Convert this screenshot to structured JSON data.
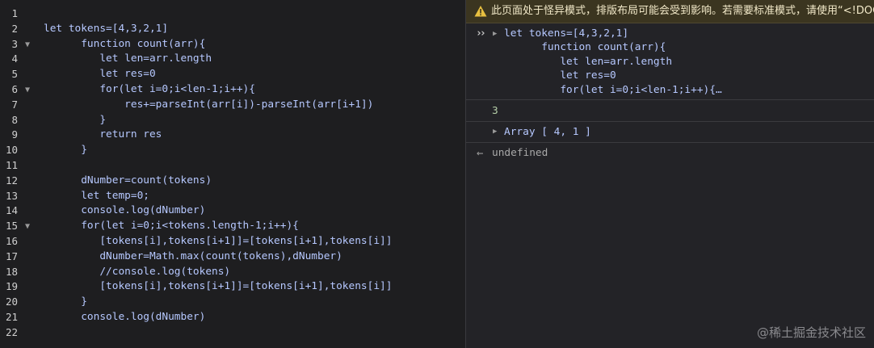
{
  "editor": {
    "lines": [
      {
        "n": "1",
        "fold": false,
        "text": ""
      },
      {
        "n": "2",
        "fold": false,
        "text": "let tokens=[4,3,2,1]"
      },
      {
        "n": "3",
        "fold": true,
        "text": "      function count(arr){"
      },
      {
        "n": "4",
        "fold": false,
        "text": "         let len=arr.length"
      },
      {
        "n": "5",
        "fold": false,
        "text": "         let res=0"
      },
      {
        "n": "6",
        "fold": true,
        "text": "         for(let i=0;i<len-1;i++){"
      },
      {
        "n": "7",
        "fold": false,
        "text": "             res+=parseInt(arr[i])-parseInt(arr[i+1])"
      },
      {
        "n": "8",
        "fold": false,
        "text": "         }"
      },
      {
        "n": "9",
        "fold": false,
        "text": "         return res"
      },
      {
        "n": "10",
        "fold": false,
        "text": "      }"
      },
      {
        "n": "11",
        "fold": false,
        "text": ""
      },
      {
        "n": "12",
        "fold": false,
        "text": "      dNumber=count(tokens)"
      },
      {
        "n": "13",
        "fold": false,
        "text": "      let temp=0;"
      },
      {
        "n": "14",
        "fold": false,
        "text": "      console.log(dNumber)"
      },
      {
        "n": "15",
        "fold": true,
        "text": "      for(let i=0;i<tokens.length-1;i++){"
      },
      {
        "n": "16",
        "fold": false,
        "text": "         [tokens[i],tokens[i+1]]=[tokens[i+1],tokens[i]]"
      },
      {
        "n": "17",
        "fold": false,
        "text": "         dNumber=Math.max(count(tokens),dNumber)"
      },
      {
        "n": "18",
        "fold": false,
        "text": "         //console.log(tokens)"
      },
      {
        "n": "19",
        "fold": false,
        "text": "         [tokens[i],tokens[i+1]]=[tokens[i+1],tokens[i]]"
      },
      {
        "n": "20",
        "fold": false,
        "text": "      }"
      },
      {
        "n": "21",
        "fold": false,
        "text": "      console.log(dNumber)"
      },
      {
        "n": "22",
        "fold": false,
        "text": ""
      }
    ]
  },
  "console": {
    "warning": "此页面处于怪异模式，排版布局可能会受到影响。若需要标准模式，请使用“<!DOCTYPE html>”。",
    "input_lines": [
      "let tokens=[4,3,2,1]",
      "      function count(arr){",
      "         let len=arr.length",
      "         let res=0",
      "         for(let i=0;i<len-1;i++){…"
    ],
    "output_number": "3",
    "output_array": "Array [ 4, 1 ]",
    "return_value": "undefined"
  },
  "watermark": "@稀土掘金技术社区",
  "colors": {
    "editor_bg": "#1e1e20",
    "console_bg": "#232327",
    "warning_bg": "#3b3520",
    "code_text": "#b6c8ff",
    "number_green": "#b5cea8"
  }
}
